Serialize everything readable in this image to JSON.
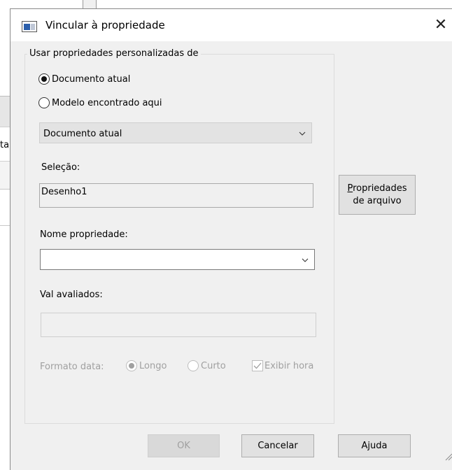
{
  "background": {
    "partial_text": "ta"
  },
  "dialog": {
    "title": "Vincular à propriedade",
    "close_glyph": "✕"
  },
  "group": {
    "legend": "Usar propriedades personalizadas de",
    "radio_current_doc": "Documento atual",
    "radio_model": "Modelo encontrado aqui",
    "source_combo_value": "Documento atual"
  },
  "selection": {
    "label": "Seleção:",
    "value": "Desenho1"
  },
  "property_name": {
    "label": "Nome propriedade:",
    "value": ""
  },
  "evaluated": {
    "label": "Val avaliados:",
    "value": ""
  },
  "date_format": {
    "label": "Formato data:",
    "long": "Longo",
    "short": "Curto",
    "show_time": "Exibir hora"
  },
  "buttons": {
    "file_props_line1": "Propriedades",
    "file_props_line2": "de arquivo",
    "ok": "OK",
    "cancel": "Cancelar",
    "help": "Ajuda"
  },
  "colors": {
    "dialog_bg": "#f0f0f0",
    "title_bg": "#ffffff",
    "disabled_text": "#a0a0a0"
  }
}
